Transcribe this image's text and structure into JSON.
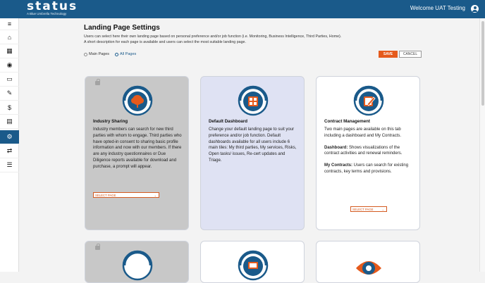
{
  "header": {
    "logo": "status",
    "tagline": "A Blue Umbrella Technology",
    "welcome": "Welcome UAT Testing"
  },
  "sidebar": {
    "items": [
      {
        "icon": "menu-icon",
        "glyph": "≡"
      },
      {
        "icon": "home-icon",
        "glyph": "⌂"
      },
      {
        "icon": "building-icon",
        "glyph": "▦"
      },
      {
        "icon": "eye-icon",
        "glyph": "◉"
      },
      {
        "icon": "monitor-icon",
        "glyph": "▭"
      },
      {
        "icon": "edit-icon",
        "glyph": "✎"
      },
      {
        "icon": "dollar-icon",
        "glyph": "$"
      },
      {
        "icon": "document-icon",
        "glyph": "▤"
      },
      {
        "icon": "chart-icon",
        "glyph": "▁▃▅"
      },
      {
        "icon": "gear-icon",
        "glyph": "⚙"
      },
      {
        "icon": "transfer-icon",
        "glyph": "⇄"
      },
      {
        "icon": "list-icon",
        "glyph": "☰"
      }
    ]
  },
  "page": {
    "title": "Landing Page Settings",
    "description_1": "Users can select here their own landing page based on personal preference and/or job function (i.e. Monitoring, Business Intelligence, Third Parties, Home).",
    "description_2": "A short description for each page is available and users can select the most suitable landing page.",
    "radio_main": "Main Pages",
    "radio_all": "All Pages",
    "save": "SAVE",
    "cancel": "CANCEL"
  },
  "cards": {
    "industry": {
      "title": "Industry Sharing",
      "text": "Industry members can search for new third parties with whom to engage. Third parties who have opted-in consent to sharing basic profile information and now with our members. If there are any industry questionnaires or Due Diligence reports available for download and purchase, a prompt will appear.",
      "select": "SELECT PAGE"
    },
    "dashboard": {
      "title": "Default Dashboard",
      "text": "Change your default landing page to suit your preference and/or job function. Default dashboards available for all users include 6 main tiles: My third parties, My services, Risks, Open tasks/ issues, Re-cert updates and Triage."
    },
    "contract": {
      "title": "Contract Management",
      "text": "Two main pages are available on this tab including a dashboard and My Contracts.",
      "dash_label": "Dashboard:",
      "dash_text": " Shows visualizations of the contract activities and renewal reminders.",
      "mc_label": "My Contracts:",
      "mc_text": " Users can search for existing contracts, key terms and provisions.",
      "select": "SELECT PAGE"
    }
  },
  "colors": {
    "brand": "#1a5a8a",
    "accent": "#e55a1c"
  }
}
